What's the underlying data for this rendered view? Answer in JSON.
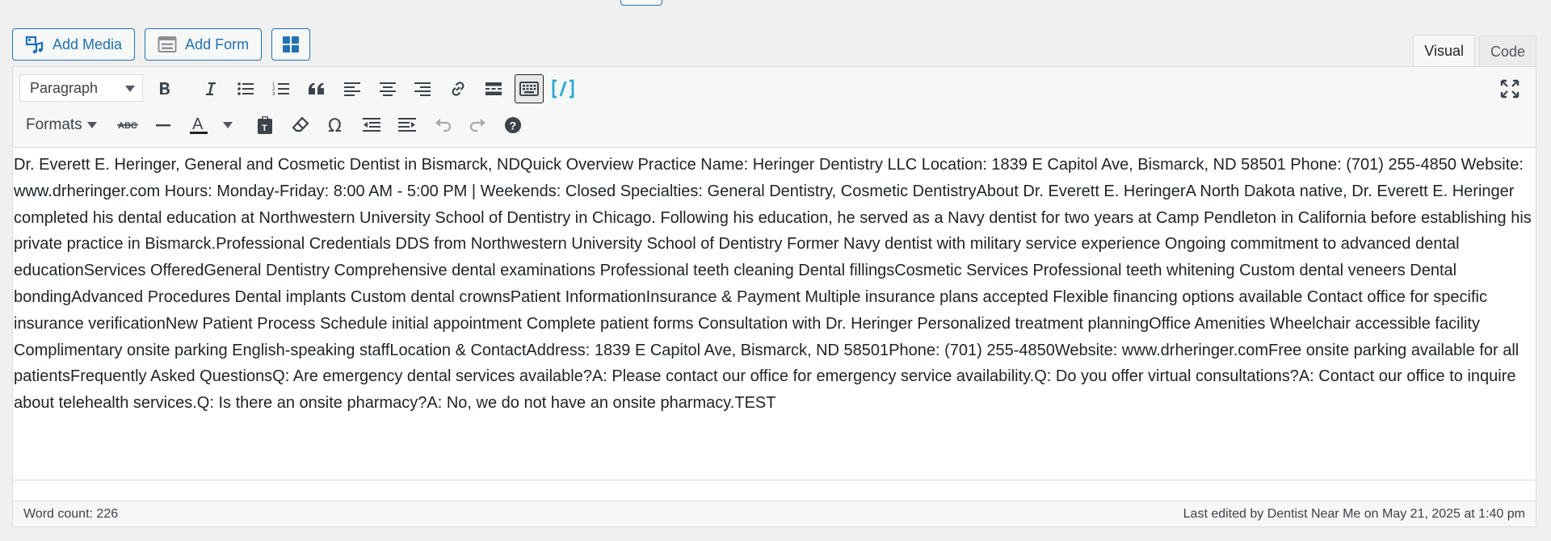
{
  "media_buttons": {
    "add_media": "Add Media",
    "add_form": "Add Form",
    "blocks_icon": "grid-icon"
  },
  "mode_tabs": {
    "visual": "Visual",
    "code": "Code",
    "active": "Visual"
  },
  "toolbar": {
    "paragraph_select": "Paragraph",
    "formats_label": "Formats",
    "row1_icons": [
      "bold-icon",
      "italic-icon",
      "bulleted-list-icon",
      "numbered-list-icon",
      "blockquote-icon",
      "align-left-icon",
      "align-center-icon",
      "align-right-icon",
      "insert-link-icon",
      "read-more-icon",
      "toolbar-toggle-icon",
      "shortcode-icon",
      "fullscreen-icon"
    ],
    "row2_icons": [
      "strikethrough-icon",
      "horizontal-line-icon",
      "text-color-icon",
      "paste-as-text-icon",
      "clear-formatting-icon",
      "special-character-icon",
      "outdent-icon",
      "indent-icon",
      "undo-icon",
      "redo-icon",
      "help-icon"
    ],
    "shortcode_color": "#29a9d6"
  },
  "content": {
    "body": "Dr. Everett E. Heringer, General and Cosmetic Dentist in Bismarck, NDQuick Overview Practice Name: Heringer Dentistry LLC Location: 1839 E Capitol Ave, Bismarck, ND 58501 Phone: (701) 255-4850 Website: www.drheringer.com Hours: Monday-Friday: 8:00 AM - 5:00 PM | Weekends: Closed Specialties: General Dentistry, Cosmetic DentistryAbout Dr. Everett E. HeringerA North Dakota native, Dr. Everett E. Heringer completed his dental education at Northwestern University School of Dentistry in Chicago. Following his education, he served as a Navy dentist for two years at Camp Pendleton in California before establishing his private practice in Bismarck.Professional Credentials DDS from Northwestern University School of Dentistry Former Navy dentist with military service experience Ongoing commitment to advanced dental educationServices OfferedGeneral Dentistry Comprehensive dental examinations Professional teeth cleaning Dental fillingsCosmetic Services Professional teeth whitening Custom dental veneers Dental bondingAdvanced Procedures Dental implants Custom dental crownsPatient InformationInsurance & Payment Multiple insurance plans accepted Flexible financing options available Contact office for specific insurance verificationNew Patient Process Schedule initial appointment Complete patient forms Consultation with Dr. Heringer Personalized treatment planningOffice Amenities Wheelchair accessible facility Complimentary onsite parking English-speaking staffLocation & ContactAddress: 1839 E Capitol Ave, Bismarck, ND 58501Phone: (701) 255-4850Website: www.drheringer.comFree onsite parking available for all patientsFrequently Asked QuestionsQ: Are emergency dental services available?A: Please contact our office for emergency service availability.Q: Do you offer virtual consultations?A: Contact our office to inquire about telehealth services.Q: Is there an onsite pharmacy?A: No, we do not have an onsite pharmacy.TEST"
  },
  "status": {
    "word_count": "Word count: 226",
    "last_edited": "Last edited by Dentist Near Me on May 21, 2025 at 1:40 pm"
  },
  "colors": {
    "accent": "#2271b1",
    "background": "#f0f0f1",
    "toolbar_bg": "#f6f7f7",
    "border": "#dcdcde"
  }
}
